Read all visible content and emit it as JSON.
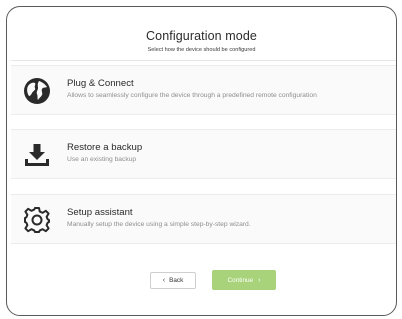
{
  "header": {
    "title": "Configuration mode",
    "subtitle": "Select how the device should be configured"
  },
  "options": [
    {
      "icon": "globe-icon",
      "title": "Plug & Connect",
      "description": "Allows to seamlessly configure the device through a predefined remote configuration"
    },
    {
      "icon": "download-icon",
      "title": "Restore a backup",
      "description": "Use an existing backup"
    },
    {
      "icon": "gear-icon",
      "title": "Setup assistant",
      "description": "Manually setup the device using a simple step-by-step wizard."
    }
  ],
  "buttons": {
    "back_label": "Back",
    "continue_label": "Continue"
  },
  "colors": {
    "accent": "#a8d37a",
    "icon": "#2a2a2a"
  }
}
